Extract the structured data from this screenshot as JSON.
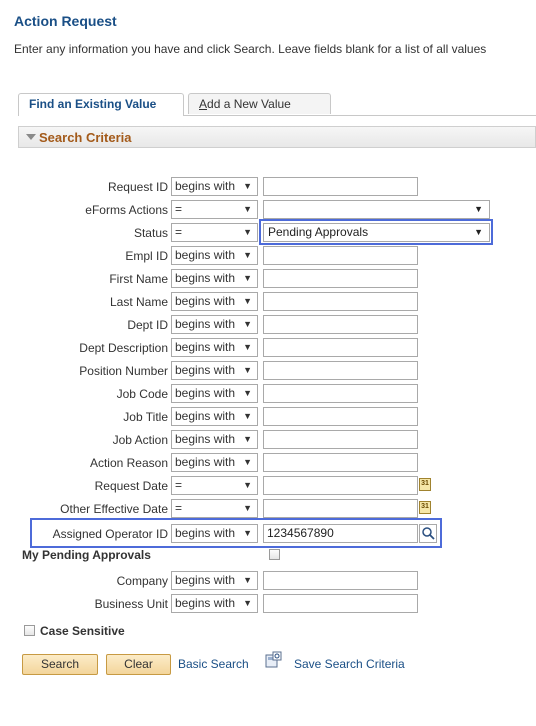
{
  "page": {
    "title": "Action Request",
    "instructions": "Enter any information you have and click Search. Leave fields blank for a list of all values"
  },
  "tabs": [
    {
      "label": "Find an Existing Value",
      "active": true
    },
    {
      "label_underline": "A",
      "label_rest": "dd a New Value",
      "active": false
    }
  ],
  "criteria": {
    "header": "Search Criteria"
  },
  "fields": {
    "request_id": {
      "label": "Request ID",
      "op": "begins with",
      "value": ""
    },
    "eforms_actions": {
      "label": "eForms Actions",
      "op": "=",
      "value": ""
    },
    "status": {
      "label": "Status",
      "op": "=",
      "value": "Pending Approvals"
    },
    "empl_id": {
      "label": "Empl ID",
      "op": "begins with",
      "value": ""
    },
    "first_name": {
      "label": "First Name",
      "op": "begins with",
      "value": ""
    },
    "last_name": {
      "label": "Last Name",
      "op": "begins with",
      "value": ""
    },
    "dept_id": {
      "label": "Dept ID",
      "op": "begins with",
      "value": ""
    },
    "dept_description": {
      "label": "Dept Description",
      "op": "begins with",
      "value": ""
    },
    "position_number": {
      "label": "Position Number",
      "op": "begins with",
      "value": ""
    },
    "job_code": {
      "label": "Job Code",
      "op": "begins with",
      "value": ""
    },
    "job_title": {
      "label": "Job Title",
      "op": "begins with",
      "value": ""
    },
    "job_action": {
      "label": "Job Action",
      "op": "begins with",
      "value": ""
    },
    "action_reason": {
      "label": "Action Reason",
      "op": "begins with",
      "value": ""
    },
    "request_date": {
      "label": "Request Date",
      "op": "=",
      "value": ""
    },
    "other_effective_date": {
      "label": "Other Effective Date",
      "op": "=",
      "value": ""
    },
    "assigned_operator_id": {
      "label": "Assigned Operator ID",
      "op": "begins with",
      "value": "1234567890"
    },
    "my_pending_approvals": {
      "label": "My Pending Approvals",
      "checked": false
    },
    "company": {
      "label": "Company",
      "op": "begins with",
      "value": ""
    },
    "business_unit": {
      "label": "Business Unit",
      "op": "begins with",
      "value": ""
    },
    "case_sensitive": {
      "label": "Case Sensitive",
      "checked": false
    }
  },
  "icons": {
    "dropdown": "▼",
    "calendar": "31"
  },
  "actions": {
    "search": "Search",
    "clear": "Clear",
    "basic_search": "Basic Search",
    "save_search_criteria": "Save Search Criteria"
  },
  "colors": {
    "title": "#1a4f86",
    "header_text": "#a35a1a",
    "highlight": "#4d6bd9"
  }
}
